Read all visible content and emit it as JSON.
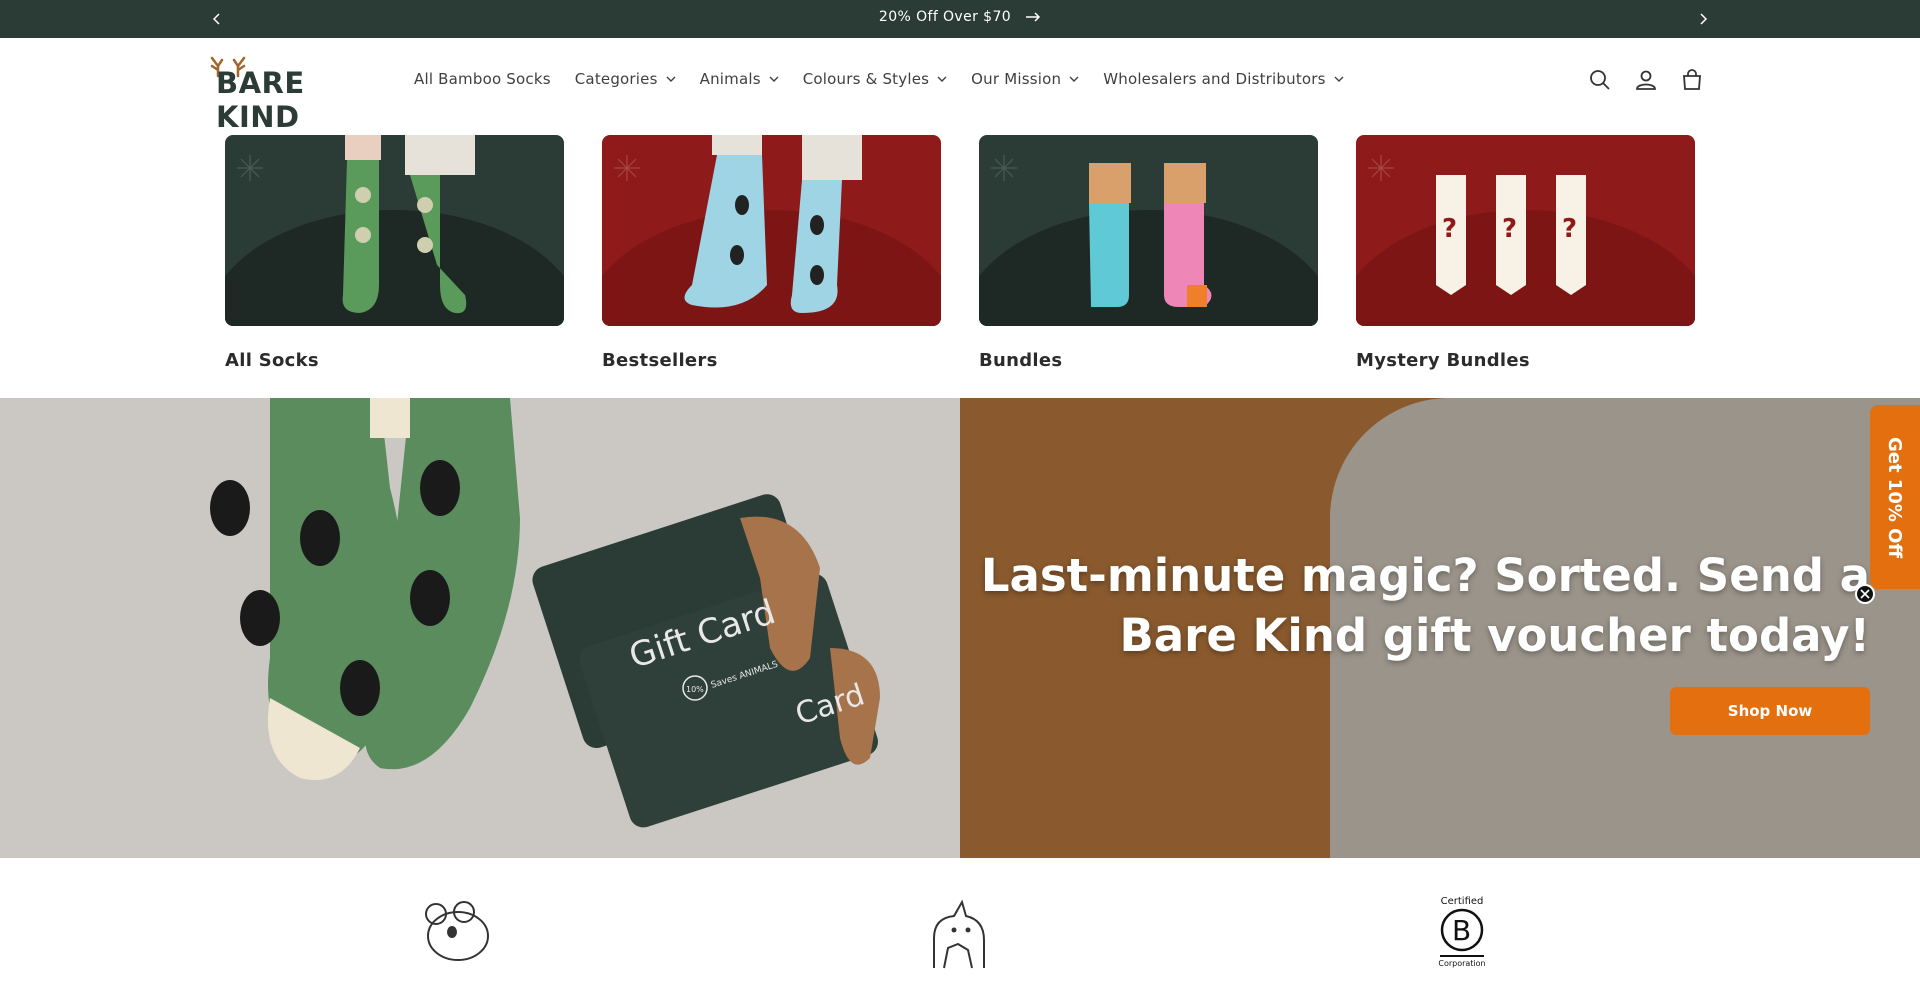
{
  "announcement": {
    "text": "20% Off Over $70",
    "prev_icon": "chevron-left-icon",
    "next_icon": "chevron-right-icon"
  },
  "header": {
    "logo_text": "BARE KIND",
    "nav": [
      {
        "label": "All Bamboo Socks",
        "has_dropdown": false
      },
      {
        "label": "Categories",
        "has_dropdown": true
      },
      {
        "label": "Animals",
        "has_dropdown": true
      },
      {
        "label": "Colours & Styles",
        "has_dropdown": true
      },
      {
        "label": "Our Mission",
        "has_dropdown": true
      },
      {
        "label": "Wholesalers and Distributors",
        "has_dropdown": true
      }
    ],
    "icons": [
      "search-icon",
      "account-icon",
      "cart-icon"
    ]
  },
  "categories": [
    {
      "label": "All Socks",
      "theme": "green"
    },
    {
      "label": "Bestsellers",
      "theme": "red"
    },
    {
      "label": "Bundles",
      "theme": "green"
    },
    {
      "label": "Mystery Bundles",
      "theme": "red"
    }
  ],
  "hero": {
    "heading": "Last-minute magic? Sorted. Send a Bare Kind gift voucher today!",
    "button_label": "Shop Now",
    "gift_card_text": "Gift Card",
    "card_text_2": "Card",
    "badge_pct": "10%",
    "badge_text": "Saves ANIMALS"
  },
  "side_tab": {
    "label": "Get 10% Off",
    "close_icon": "close-icon"
  },
  "features": {
    "icons": [
      "koala-icon",
      "animals-group-icon",
      "b-corp-icon"
    ],
    "bcorp_certified": "Certified",
    "bcorp_corporation": "Corporation"
  },
  "colors": {
    "dark_green": "#2b3b36",
    "accent_orange": "#e46f0f",
    "deep_red": "#8e1a1a"
  }
}
